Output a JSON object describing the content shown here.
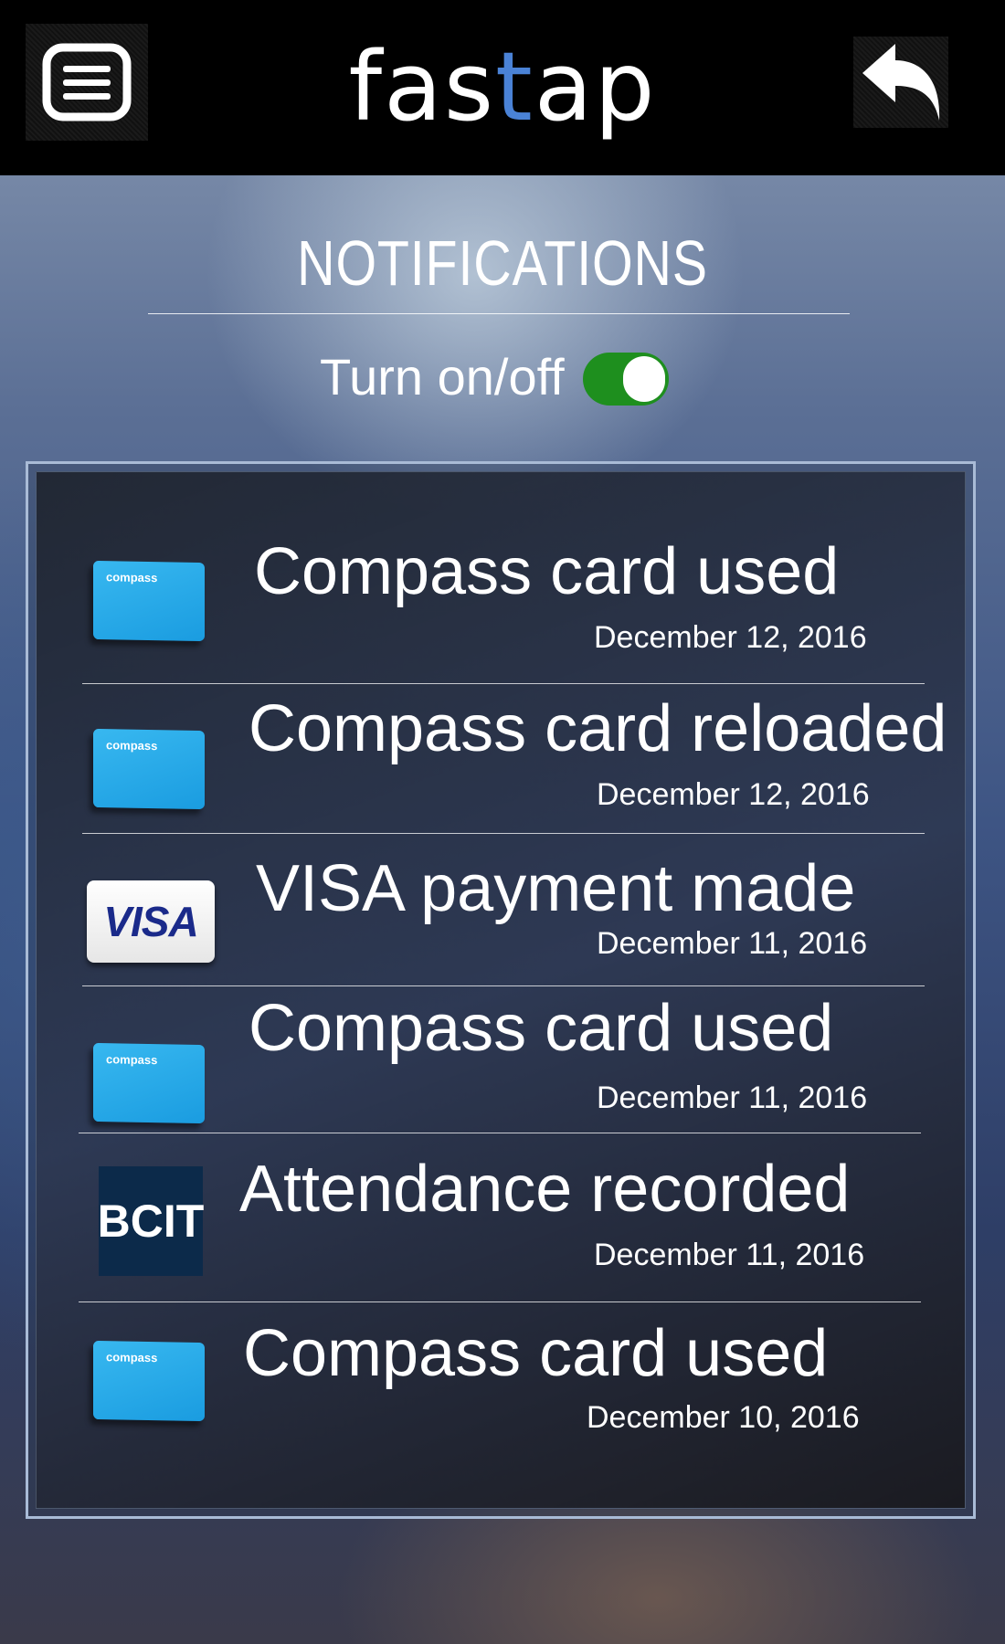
{
  "header": {
    "logo_pre": "fas",
    "logo_accent": "t",
    "logo_post": "ap",
    "menu_icon": "menu-icon",
    "back_icon": "back-arrow-icon",
    "accent_color": "#4a82d6"
  },
  "page": {
    "title": "NOTIFICATIONS",
    "toggle_label": "Turn on/off",
    "toggle_on": true,
    "toggle_color": "#1e8f1e"
  },
  "notifications": [
    {
      "icon": "compass-card-icon",
      "icon_text": "compass",
      "title": "Compass card used",
      "date": "December 12, 2016"
    },
    {
      "icon": "compass-card-icon",
      "icon_text": "compass",
      "title": "Compass card reloaded",
      "date": "December 12, 2016"
    },
    {
      "icon": "visa-card-icon",
      "icon_text": "VISA",
      "title": "VISA payment made",
      "date": "December 11, 2016"
    },
    {
      "icon": "compass-card-icon",
      "icon_text": "compass",
      "title": "Compass card used",
      "date": "December 11, 2016"
    },
    {
      "icon": "bcit-logo-icon",
      "icon_text": "BCIT",
      "title": "Attendance recorded",
      "date": "December 11, 2016"
    },
    {
      "icon": "compass-card-icon",
      "icon_text": "compass",
      "title": "Compass card used",
      "date": "December 10, 2016"
    }
  ]
}
